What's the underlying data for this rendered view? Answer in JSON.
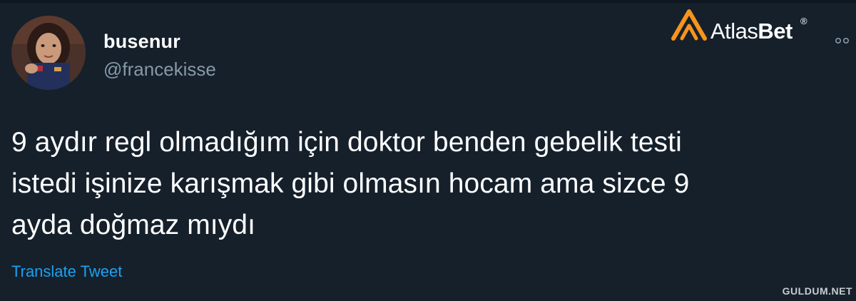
{
  "tweet": {
    "display_name": "busenur",
    "username": "@francekisse",
    "lines": [
      "9 aydır regl olmadığım için doktor benden gebelik testi",
      "istedi işinize karışmak gibi olmasın hocam ama sizce 9",
      "ayda doğmaz mıydı"
    ],
    "translate_label": "Translate Tweet"
  },
  "watermarks": {
    "logo_light": "Atlas",
    "logo_bold": "Bet",
    "logo_registered": "®",
    "site": "GULDUM.NET"
  },
  "icons": {
    "more": "more-options-icon",
    "logo": "atlasbet-logo-mark"
  },
  "colors": {
    "background": "#15202b",
    "text_primary": "#ffffff",
    "text_secondary": "#8899a6",
    "link": "#1da1f2",
    "logo_orange": "#f7931e"
  }
}
